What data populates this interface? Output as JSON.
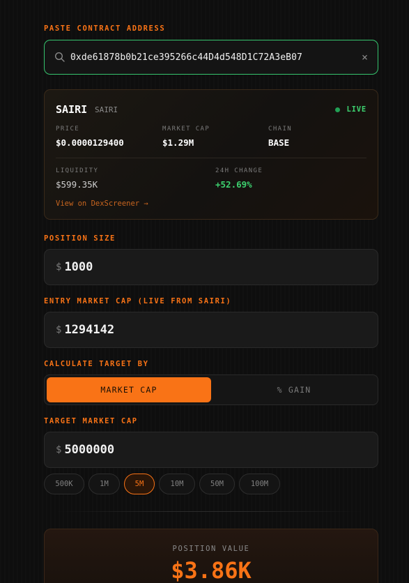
{
  "contract": {
    "label": "PASTE CONTRACT ADDRESS",
    "value": "0xde61878b0b21ce395266c44D4d548D1C72A3eB07",
    "clear_glyph": "×"
  },
  "token": {
    "name": "SAIRI",
    "symbol": "SAIRI",
    "status": "LIVE",
    "price_label": "PRICE",
    "price": "$0.0000129400",
    "mcap_label": "MARKET CAP",
    "mcap": "$1.29M",
    "chain_label": "CHAIN",
    "chain": "BASE",
    "liquidity_label": "LIQUIDITY",
    "liquidity": "$599.35K",
    "change_label": "24H CHANGE",
    "change": "+52.69%",
    "dex_link": "View on DexScreener →"
  },
  "position": {
    "label": "POSITION SIZE",
    "currency": "$",
    "value": "1000"
  },
  "entry": {
    "label": "ENTRY MARKET CAP (LIVE FROM SAIRI)",
    "currency": "$",
    "value": "1294142"
  },
  "calc_by": {
    "label": "CALCULATE TARGET BY",
    "options": [
      "MARKET CAP",
      "% GAIN"
    ],
    "selected": "MARKET CAP"
  },
  "target": {
    "label": "TARGET MARKET CAP",
    "currency": "$",
    "value": "5000000",
    "presets": [
      "500K",
      "1M",
      "5M",
      "10M",
      "50M",
      "100M"
    ],
    "selected_preset": "5M"
  },
  "result": {
    "label": "POSITION VALUE",
    "value": "$3.86K"
  },
  "colors": {
    "accent": "#f97316",
    "live_green": "#3dd16f",
    "focus_border": "#36c46e",
    "background": "#0e0e0e"
  }
}
